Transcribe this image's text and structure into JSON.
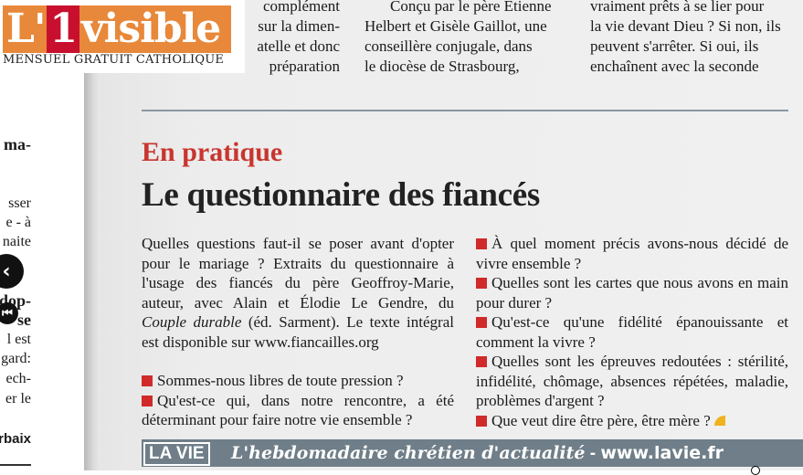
{
  "logo": {
    "prefix": "L'",
    "one": "1",
    "word": "visible",
    "subtitle": "MENSUEL GRATUIT CATHOLIQUE"
  },
  "left_page": {
    "lines": [
      "ma-",
      "sser",
      "e - à",
      "naite",
      "dop-",
      "se",
      "l est",
      "gard:",
      "ech-",
      "er le",
      "rbaix"
    ]
  },
  "top_columns": {
    "col1": [
      "complément",
      "sur la dimen-",
      "atelle et donc",
      "préparation"
    ],
    "col2": [
      "Conçu par le père Etienne",
      "Helbert et Gisèle Gaillot, une",
      "conseillère conjugale, dans",
      "le diocèse de Strasbourg,"
    ],
    "col3": [
      "vraiment prêts à se lier pour",
      "la vie devant Dieu ? Si non, ils",
      "peuvent s'arrêter. Si oui, ils",
      "enchaînent avec la seconde"
    ]
  },
  "article": {
    "kicker": "En pratique",
    "headline": "Le questionnaire des fiancés",
    "intro_before": "Quelles questions faut-il se poser avant d'opter pour le mariage ? Extraits du questionnaire à l'usage des fiancés du père Geoffroy-Marie, auteur, avec Alain et Élodie Le Gendre, du ",
    "intro_book": "Couple durable",
    "intro_after": " (éd. Sarment). Le texte intégral est disponible sur www.fiancailles.org",
    "questions_left": [
      "Sommes-nous libres de toute pression ?",
      "Qu'est-ce qui, dans notre rencontre, a été déterminant pour faire notre vie ensemble ?"
    ],
    "questions_right": [
      "À quel moment précis avons-nous décidé de vivre ensemble ?",
      "Quelles sont les cartes que nous avons en main pour durer ?",
      "Qu'est-ce qu'une fidélité épanouissante et comment la vivre ?",
      "Quelles sont les épreuves redoutées : stérilité, infidélité, chômage, absences répétées, maladie, problèmes d'argent ?",
      "Que veut dire être père, être mère ?"
    ]
  },
  "footer": {
    "logo": "LA VIE",
    "tagline": "L'hebdomadaire chrétien d'actualité",
    "separator": " - ",
    "url": "www.lavie.fr"
  },
  "colors": {
    "accent_red": "#c8362e",
    "logo_orange": "#e8883a",
    "footer_band": "#6f7e88"
  }
}
